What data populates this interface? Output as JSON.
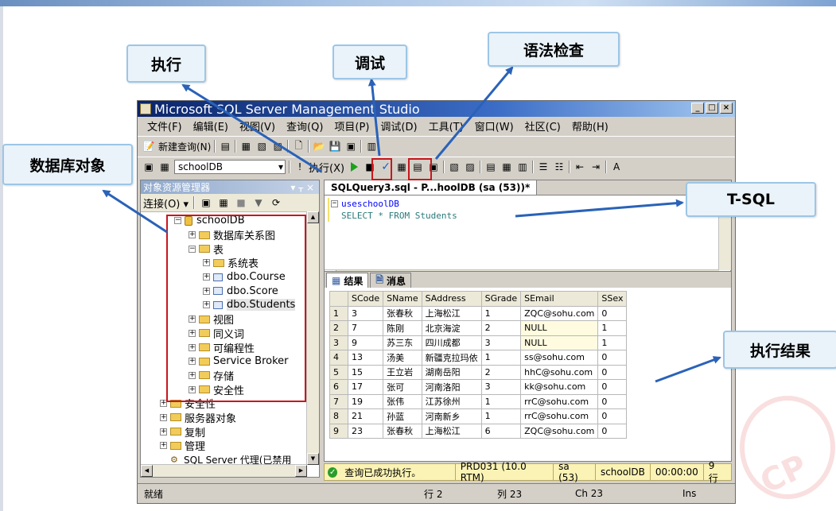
{
  "callouts": {
    "execute": "执行",
    "debug": "调试",
    "syntax_check": "语法检查",
    "db_objects": "数据库对象",
    "tsql": "T-SQL",
    "exec_result": "执行结果"
  },
  "window": {
    "title": "Microsoft SQL Server Management Studio",
    "menu": [
      "文件(F)",
      "编辑(E)",
      "视图(V)",
      "查询(Q)",
      "项目(P)",
      "调试(D)",
      "工具(T)",
      "窗口(W)",
      "社区(C)",
      "帮助(H)"
    ],
    "new_query": "新建查询(N)",
    "database": "schoolDB",
    "execute_label": "执行(X)"
  },
  "object_explorer": {
    "title": "对象资源管理器",
    "pin": "▾ ᚁ ×",
    "connect": "连接(O) ▾",
    "nodes": {
      "db": "schoolDB",
      "diagrams": "数据库关系图",
      "tables": "表",
      "sys_tables": "系统表",
      "course": "dbo.Course",
      "score": "dbo.Score",
      "students": "dbo.Students",
      "views": "视图",
      "synonyms": "同义词",
      "programmability": "可编程性",
      "service_broker": "Service Broker",
      "storage": "存储",
      "security_db": "安全性",
      "security": "安全性",
      "server_objects": "服务器对象",
      "replication": "复制",
      "management": "管理",
      "agent": "SQL Server 代理(已禁用"
    }
  },
  "editor": {
    "tab": "SQLQuery3.sql - P...hoolDB (sa (53))*",
    "line1_kw": "use",
    "line1_rest": " schoolDB",
    "line2": "SELECT * FROM Students"
  },
  "results": {
    "tab_results": "结果",
    "tab_messages": "消息",
    "columns": [
      "SCode",
      "SName",
      "SAddress",
      "SGrade",
      "SEmail",
      "SSex"
    ],
    "rows": [
      [
        "1",
        "3",
        "张春秋",
        "上海松江",
        "1",
        "ZQC@sohu.com",
        "0"
      ],
      [
        "2",
        "7",
        "陈刚",
        "北京海淀",
        "2",
        "NULL",
        "1"
      ],
      [
        "3",
        "9",
        "苏三东",
        "四川成都",
        "3",
        "NULL",
        "1"
      ],
      [
        "4",
        "13",
        "汤美",
        "新疆克拉玛依",
        "1",
        "ss@sohu.com",
        "0"
      ],
      [
        "5",
        "15",
        "王立岩",
        "湖南岳阳",
        "2",
        "hhC@sohu.com",
        "0"
      ],
      [
        "6",
        "17",
        "张可",
        "河南洛阳",
        "3",
        "kk@sohu.com",
        "0"
      ],
      [
        "7",
        "19",
        "张伟",
        "江苏徐州",
        "1",
        "rrC@sohu.com",
        "0"
      ],
      [
        "8",
        "21",
        "孙蓝",
        "河南新乡",
        "1",
        "rrC@sohu.com",
        "0"
      ],
      [
        "9",
        "23",
        "张春秋",
        "上海松江",
        "6",
        "ZQC@sohu.com",
        "0"
      ]
    ]
  },
  "query_status": {
    "message": "查询已成功执行。",
    "server": "PRD031 (10.0 RTM)",
    "user": "sa (53)",
    "db": "schoolDB",
    "time": "00:00:00",
    "rows": "9 行"
  },
  "statusbar": {
    "ready": "就绪",
    "line": "行 2",
    "col": "列 23",
    "ch": "Ch 23",
    "ins": "Ins"
  },
  "colors": {
    "callout_border": "#9cc6e6",
    "arrow": "#2a62b8",
    "highlight": "#c8171d"
  }
}
